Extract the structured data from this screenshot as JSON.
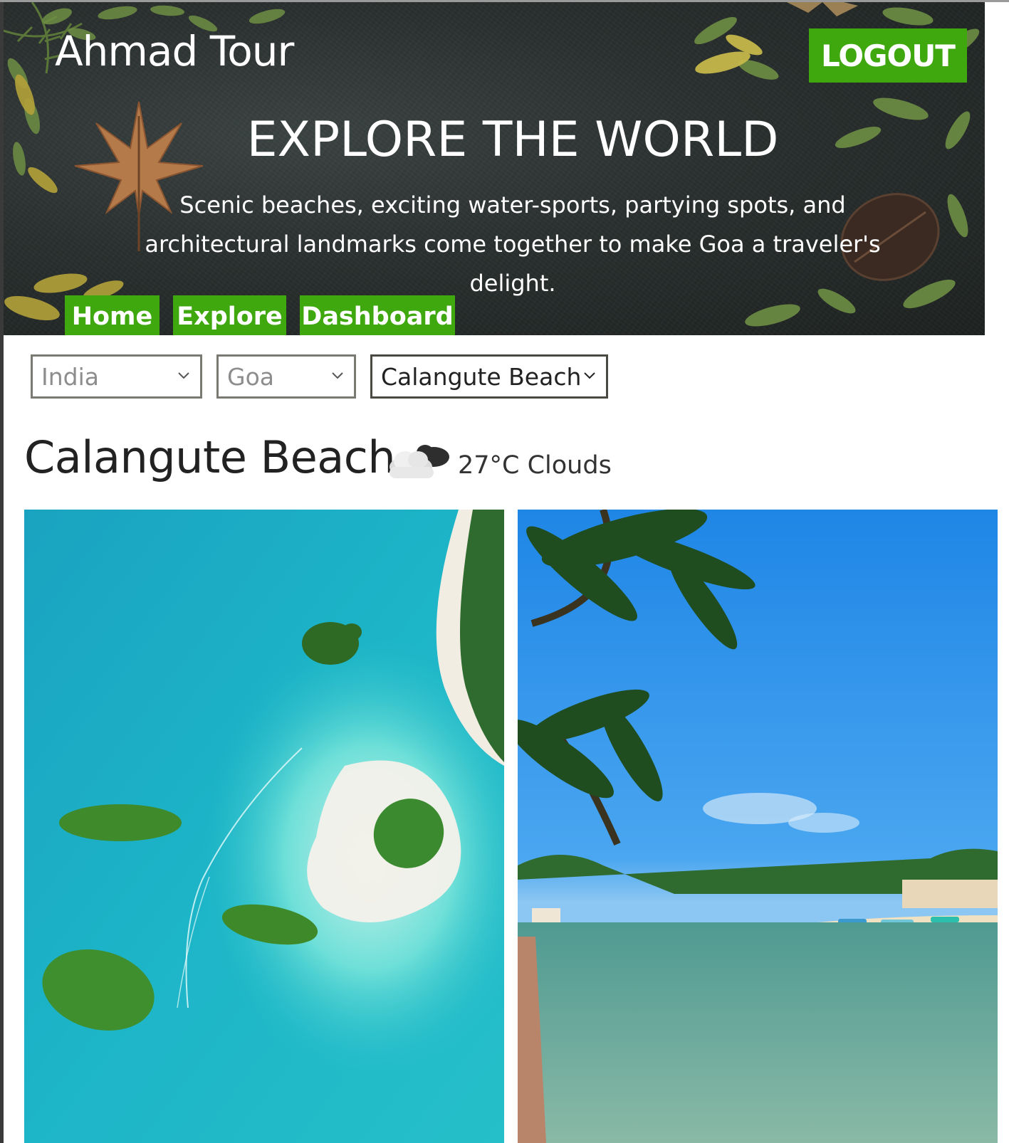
{
  "header": {
    "brand": "Ahmad Tour",
    "logout_label": "LOGOUT",
    "headline": "EXPLORE THE WORLD",
    "subtitle": "Scenic beaches, exciting water-sports, partying spots, and architectural landmarks come together to make Goa a traveler's delight."
  },
  "nav": {
    "items": [
      {
        "label": "Home"
      },
      {
        "label": "Explore"
      },
      {
        "label": "Dashboard"
      }
    ]
  },
  "filters": {
    "country": "India",
    "state": "Goa",
    "place": "Calangute Beach"
  },
  "place": {
    "title": "Calangute Beach",
    "weather_icon": "cloud-icon",
    "weather": "27°C Clouds"
  },
  "gallery": {
    "images": [
      {
        "name": "aerial-lagoon-islands-photo"
      },
      {
        "name": "palm-trees-river-beach-photo"
      }
    ]
  },
  "colors": {
    "accent_green": "#3fa80f",
    "hero_bg": "#2a302f",
    "text_dark": "#222222"
  }
}
